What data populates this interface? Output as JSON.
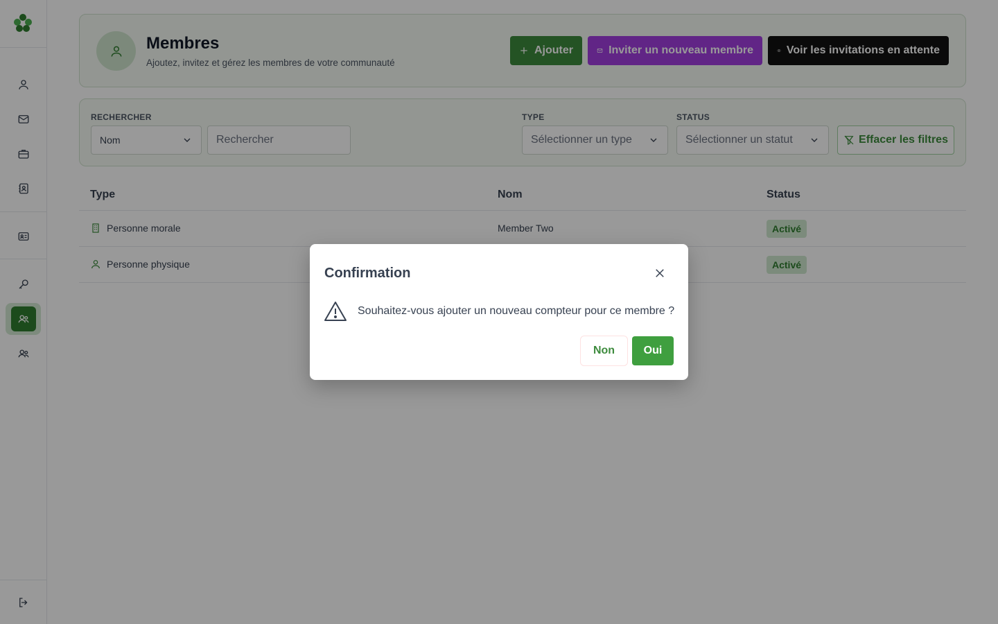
{
  "sidebar": {
    "logo_icon": "clover-logo-icon",
    "items": [
      {
        "icon": "user-icon"
      },
      {
        "icon": "mail-icon"
      },
      {
        "icon": "briefcase-icon"
      },
      {
        "icon": "contact-book-icon"
      },
      {
        "icon": "id-card-icon"
      },
      {
        "icon": "key-icon"
      },
      {
        "icon": "members-icon",
        "active": true
      },
      {
        "icon": "users-icon"
      }
    ],
    "logout_icon": "logout-icon"
  },
  "header": {
    "title": "Membres",
    "subtitle": "Ajoutez, invitez et gérez les membres de votre communauté",
    "add_label": "Ajouter",
    "invite_label": "Inviter un nouveau membre",
    "pending_label": "Voir les invitations en attente"
  },
  "filters": {
    "search_label": "RECHERCHER",
    "search_field_value": "Nom",
    "search_placeholder": "Rechercher",
    "type_label": "TYPE",
    "type_placeholder": "Sélectionner un type",
    "status_label": "STATUS",
    "status_placeholder": "Sélectionner un statut",
    "clear_label": "Effacer les filtres"
  },
  "table": {
    "columns": [
      "Type",
      "Nom",
      "Status"
    ],
    "rows": [
      {
        "type": "Personne morale",
        "type_icon": "building-icon",
        "name": "Member Two",
        "status": "Activé"
      },
      {
        "type": "Personne physique",
        "type_icon": "user-icon",
        "name": "",
        "status": "Activé"
      }
    ]
  },
  "dialog": {
    "title": "Confirmation",
    "message": "Souhaitez-vous ajouter un nouveau compteur pour ce membre ?",
    "no_label": "Non",
    "yes_label": "Oui"
  },
  "colors": {
    "primary_green": "#3d8b3d",
    "invite_purple": "#a23fe0",
    "pending_black": "#111111",
    "badge_bg": "#cfe8cf"
  }
}
